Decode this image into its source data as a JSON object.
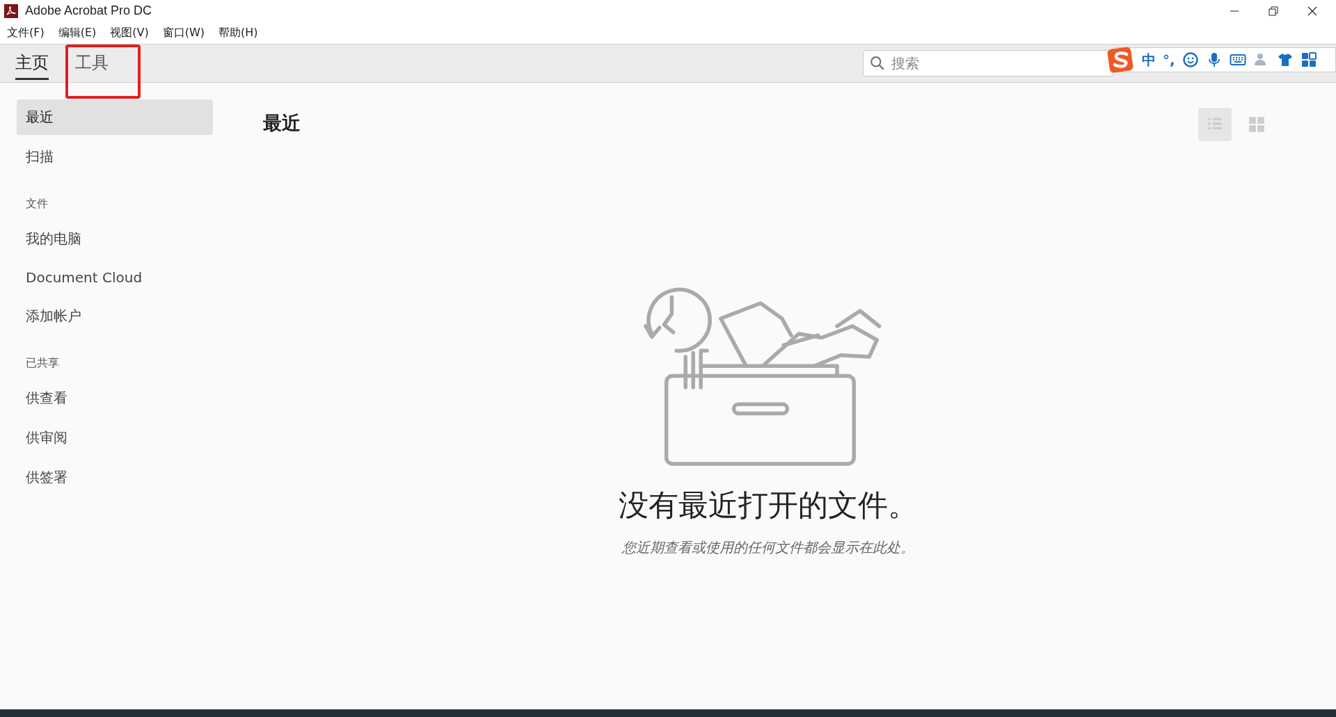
{
  "window": {
    "title": "Adobe Acrobat Pro DC"
  },
  "menu": [
    "文件(F)",
    "编辑(E)",
    "视图(V)",
    "窗口(W)",
    "帮助(H)"
  ],
  "tabs": [
    {
      "label": "主页",
      "selected": true,
      "highlighted": false
    },
    {
      "label": "工具",
      "selected": false,
      "highlighted": true
    }
  ],
  "search": {
    "placeholder": "搜索"
  },
  "ime_toolbar": {
    "mode": "中",
    "punctuation": "°,"
  },
  "sidebar": {
    "items": [
      {
        "kind": "item",
        "label": "最近",
        "selected": true
      },
      {
        "kind": "item",
        "label": "扫描",
        "selected": false
      },
      {
        "kind": "header",
        "label": "文件"
      },
      {
        "kind": "item",
        "label": "我的电脑",
        "selected": false
      },
      {
        "kind": "item",
        "label": "Document Cloud",
        "selected": false
      },
      {
        "kind": "item",
        "label": "添加帐户",
        "selected": false
      },
      {
        "kind": "header",
        "label": "已共享"
      },
      {
        "kind": "item",
        "label": "供查看",
        "selected": false
      },
      {
        "kind": "item",
        "label": "供审阅",
        "selected": false
      },
      {
        "kind": "item",
        "label": "供签署",
        "selected": false
      }
    ]
  },
  "main": {
    "heading": "最近",
    "view_modes": [
      {
        "kind": "list",
        "selected": true
      },
      {
        "kind": "grid",
        "selected": false
      }
    ],
    "empty_title": "没有最近打开的文件。",
    "empty_subtitle": "您近期查看或使用的任何文件都会显示在此处。"
  }
}
